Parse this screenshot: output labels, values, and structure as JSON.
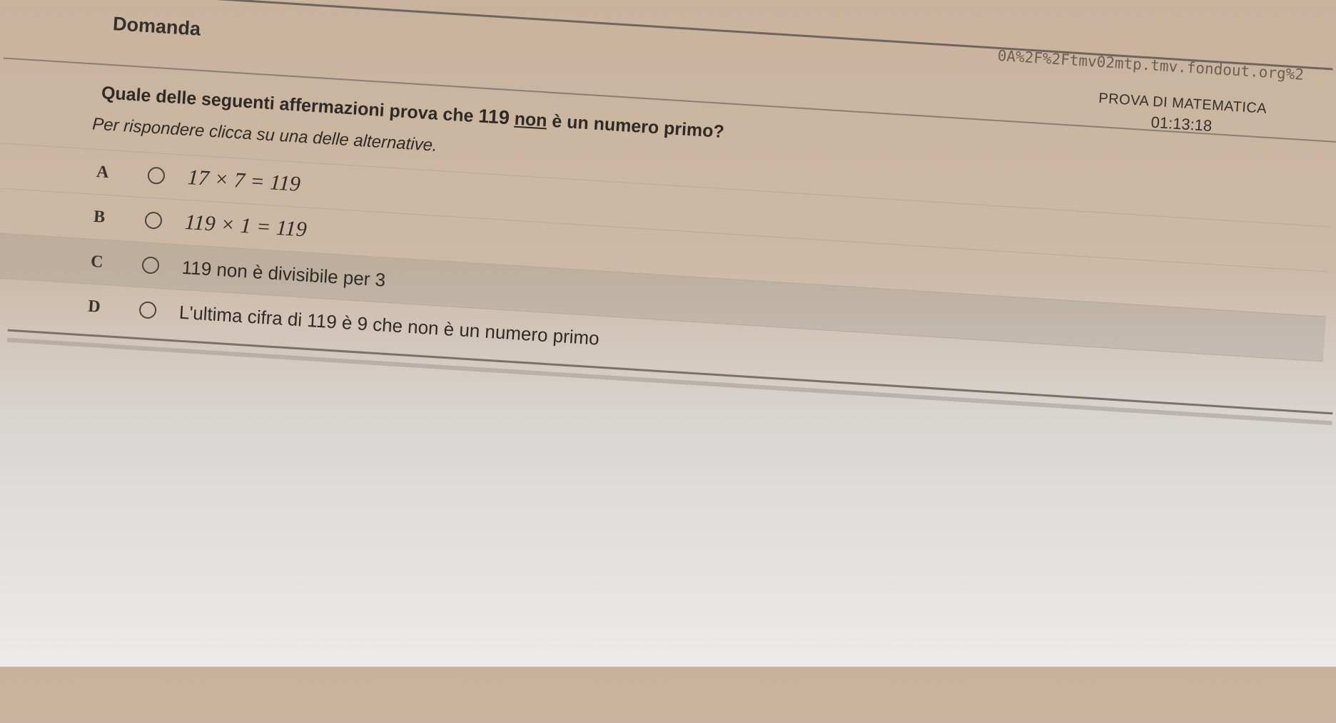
{
  "browser": {
    "url_fragment": "0A%2F%2Ftmv02mtp.tmv.fondout.org%2"
  },
  "header": {
    "title": "Domanda",
    "exam_title": "PROVA DI MATEMATICA",
    "timer": "01:13:18"
  },
  "question": {
    "prefix": "Quale delle seguenti affermazioni prova che",
    "number": "119",
    "emphasis": "non",
    "suffix": "è un numero primo?",
    "hint": "Per rispondere clicca su una delle alternative."
  },
  "options": [
    {
      "letter": "A",
      "text": "17 × 7 = 119"
    },
    {
      "letter": "B",
      "text": "119 × 1 = 119"
    },
    {
      "letter": "C",
      "text": "119 non è divisibile per 3"
    },
    {
      "letter": "D",
      "text": "L'ultima cifra di 119 è 9 che non è un numero primo"
    }
  ]
}
